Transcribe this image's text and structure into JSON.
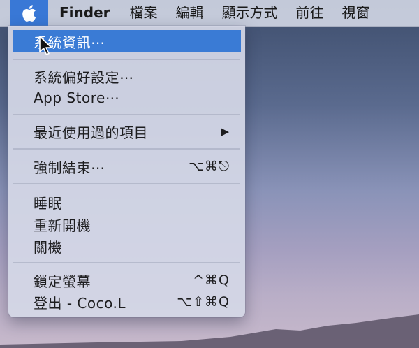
{
  "menubar": {
    "app_name": "Finder",
    "items": [
      "檔案",
      "編輯",
      "顯示方式",
      "前往",
      "視窗"
    ]
  },
  "apple_menu": {
    "items": [
      {
        "label": "系統資訊⋯",
        "shortcut": ""
      },
      {
        "label": "系統偏好設定⋯",
        "shortcut": ""
      },
      {
        "label": "App Store⋯",
        "shortcut": ""
      },
      {
        "label": "最近使用過的項目",
        "shortcut": "▶"
      },
      {
        "label": "強制結束⋯",
        "shortcut": "⌥⌘⎋"
      },
      {
        "label": "睡眠",
        "shortcut": ""
      },
      {
        "label": "重新開機",
        "shortcut": ""
      },
      {
        "label": "關機",
        "shortcut": ""
      },
      {
        "label": "鎖定螢幕",
        "shortcut": "^⌘Q"
      },
      {
        "label": "登出 - Coco.L",
        "shortcut": "⌥⇧⌘Q"
      }
    ]
  },
  "colors": {
    "highlight": "#3a7bd5",
    "menubar_bg": "#d6dbe8"
  }
}
